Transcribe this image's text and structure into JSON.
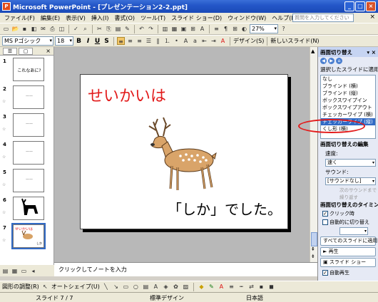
{
  "window": {
    "title": "Microsoft PowerPoint - [プレゼンテーション2-2.ppt]",
    "app_icon": "P"
  },
  "menu": {
    "items": [
      "ファイル(F)",
      "編集(E)",
      "表示(V)",
      "挿入(I)",
      "書式(O)",
      "ツール(T)",
      "スライド ショー(D)",
      "ウィンドウ(W)",
      "ヘルプ(H)"
    ],
    "help_placeholder": "質問を入力してください"
  },
  "toolbar2": {
    "font": "MS Pゴシック",
    "font_size": "18",
    "bold": "B",
    "italic": "I",
    "underline": "U",
    "shadow": "S",
    "design_label": "デザイン(S)",
    "new_slide_label": "新しいスライド(N)"
  },
  "toolbar1": {
    "zoom": "27%"
  },
  "thumbnails": {
    "numbers": [
      "1",
      "2",
      "3",
      "4",
      "5",
      "6",
      "7"
    ],
    "slide1_text": "これなあに?"
  },
  "slide": {
    "title": "せいかいは",
    "caption": "「しか」でした。"
  },
  "notes": {
    "placeholder": "クリックしてノートを入力"
  },
  "taskpane": {
    "title": "画面切り替え",
    "apply_label": "選択したスライドに適用:",
    "transitions": [
      "なし",
      "ブラインド (横)",
      "ブラインド (縦)",
      "ボックスワイプイン",
      "ボックスワイプアウト",
      "チェッカーワイプ (横)",
      "チェッカーワイプ (縦)",
      "くし形 (横)"
    ],
    "selected_transition": "チェッカーワイプ (縦)",
    "edit_label": "画面切り替えの編集",
    "speed_label": "速度:",
    "speed_value": "速く",
    "sound_label": "サウンド:",
    "sound_value": "[サウンドなし]",
    "loop_label": "次のサウンドまで繰り返す",
    "timing_label": "画面切り替えのタイミング",
    "on_click_label": "クリック時",
    "auto_label": "自動的に切り替え",
    "apply_all_label": "すべてのスライドに適用",
    "play_label": "再生",
    "slideshow_label": "スライド ショー",
    "autopreview_label": "自動再生"
  },
  "drawbar": {
    "draw_label": "図形の調整(R)",
    "autoshape_label": "オートシェイプ(U)"
  },
  "status": {
    "slide": "スライド 7 / 7",
    "design": "標準デザイン",
    "language": "日本語"
  }
}
